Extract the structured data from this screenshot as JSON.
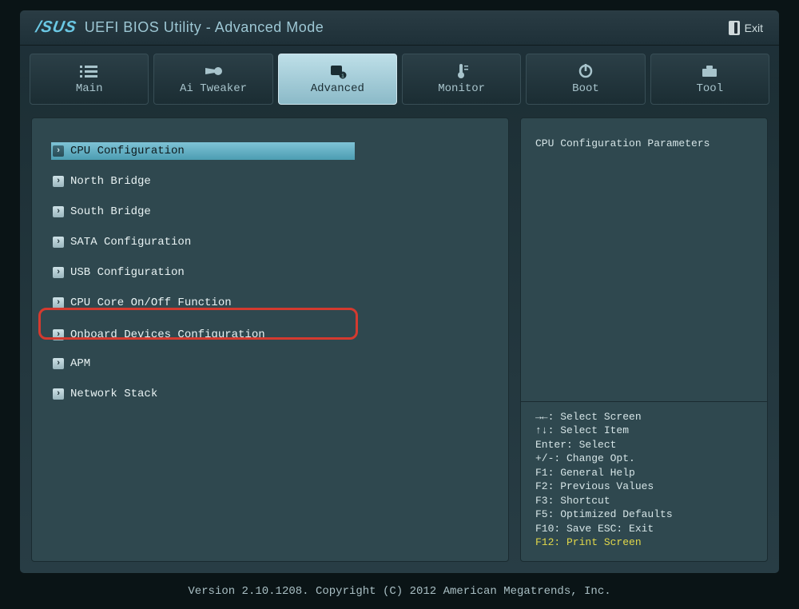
{
  "header": {
    "brand": "/SUS",
    "title": "UEFI BIOS Utility - Advanced Mode",
    "exit_label": "Exit"
  },
  "tabs": [
    {
      "id": "main",
      "label": "Main"
    },
    {
      "id": "ai-tweaker",
      "label": "Ai Tweaker"
    },
    {
      "id": "advanced",
      "label": "Advanced"
    },
    {
      "id": "monitor",
      "label": "Monitor"
    },
    {
      "id": "boot",
      "label": "Boot"
    },
    {
      "id": "tool",
      "label": "Tool"
    }
  ],
  "menu": {
    "items": [
      {
        "label": "CPU Configuration"
      },
      {
        "label": "North Bridge"
      },
      {
        "label": "South Bridge"
      },
      {
        "label": "SATA Configuration"
      },
      {
        "label": "USB Configuration"
      },
      {
        "label": "CPU Core On/Off Function"
      },
      {
        "label": "Onboard Devices Configuration"
      },
      {
        "label": "APM"
      },
      {
        "label": "Network Stack"
      }
    ]
  },
  "help": {
    "description": "CPU Configuration Parameters",
    "keys": {
      "l0": "→←: Select Screen",
      "l1": "↑↓: Select Item",
      "l2": "Enter: Select",
      "l3": "+/-: Change Opt.",
      "l4": "F1: General Help",
      "l5": "F2: Previous Values",
      "l6": "F3: Shortcut",
      "l7": "F5: Optimized Defaults",
      "l8": "F10: Save  ESC: Exit",
      "l9": "F12: Print Screen"
    }
  },
  "footer": "Version 2.10.1208. Copyright (C) 2012 American Megatrends, Inc."
}
